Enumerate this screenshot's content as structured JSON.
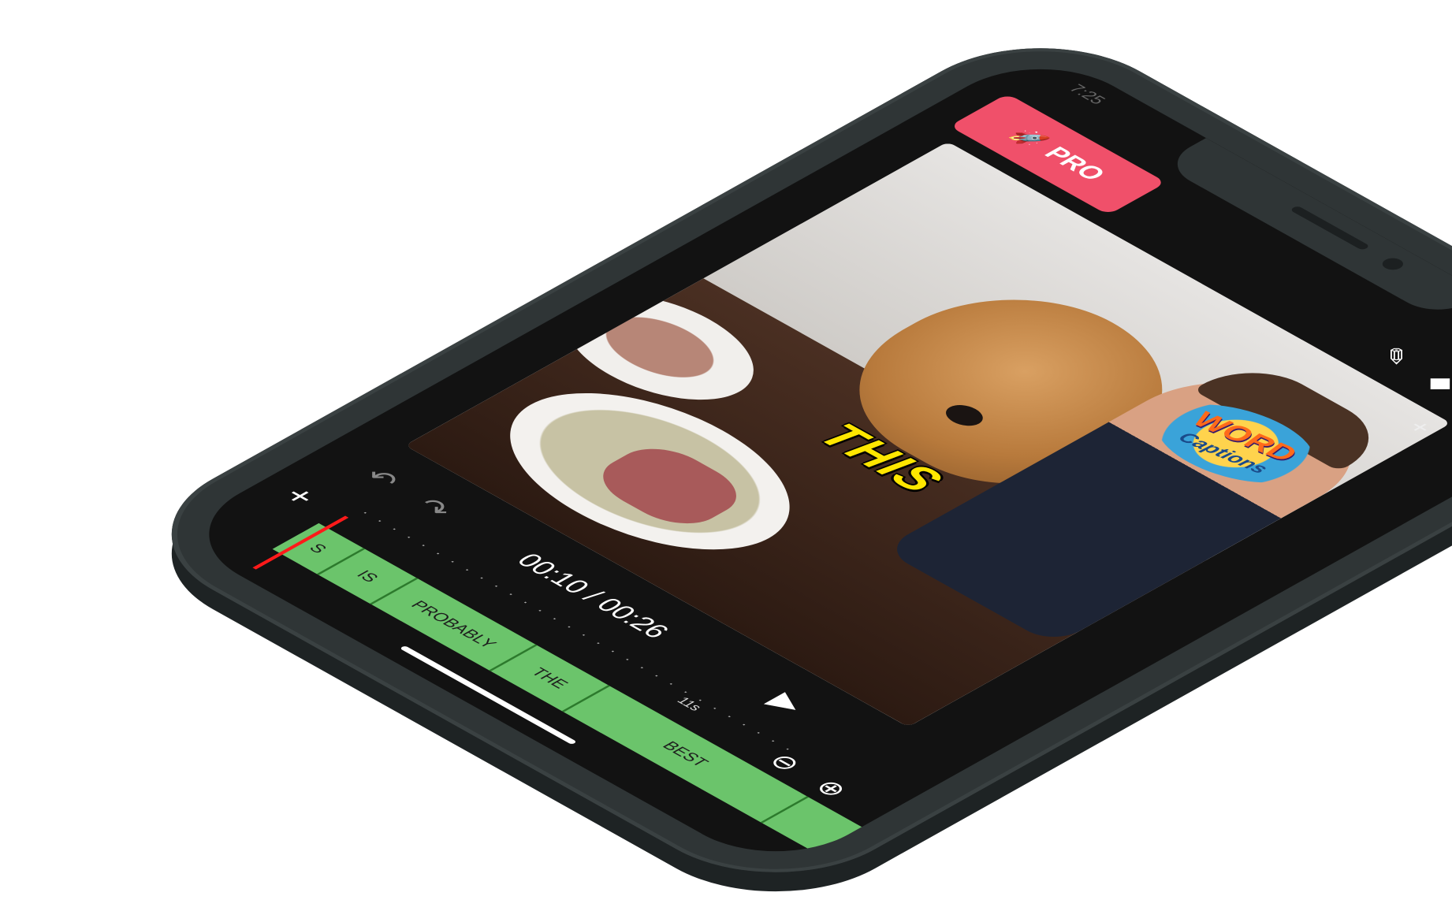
{
  "app": {
    "pro_label": "PRO",
    "status_left": "7:25",
    "status_right": "◣ ◼"
  },
  "top_tools": {
    "edit_icon": "✎",
    "layers_icon": "◆",
    "download_icon": "⤓"
  },
  "video": {
    "caption_word": "THIS",
    "logo_word": "WORD",
    "logo_captions": "Captions",
    "close_icon": "+"
  },
  "player": {
    "undo_icon": "↶",
    "redo_icon": "↷",
    "time": "00:10 / 00:26",
    "play_icon": "▶",
    "add_icon": "+",
    "zoom_out_icon": "⊖",
    "zoom_in_icon": "⊕",
    "tick_label": "11s"
  },
  "timeline": {
    "clips": [
      {
        "label": "S",
        "width": 70
      },
      {
        "label": "IS",
        "width": 80
      },
      {
        "label": "PROBABLY",
        "width": 180
      },
      {
        "label": "THE",
        "width": 110
      },
      {
        "label": "BEST",
        "width": 300
      },
      {
        "label": "",
        "width": 100
      }
    ]
  },
  "colors": {
    "pro_accent": "#f0506a",
    "clip_green": "#6bc46b",
    "playhead_red": "#ff1a1a",
    "caption_yellow": "#ffe600"
  }
}
